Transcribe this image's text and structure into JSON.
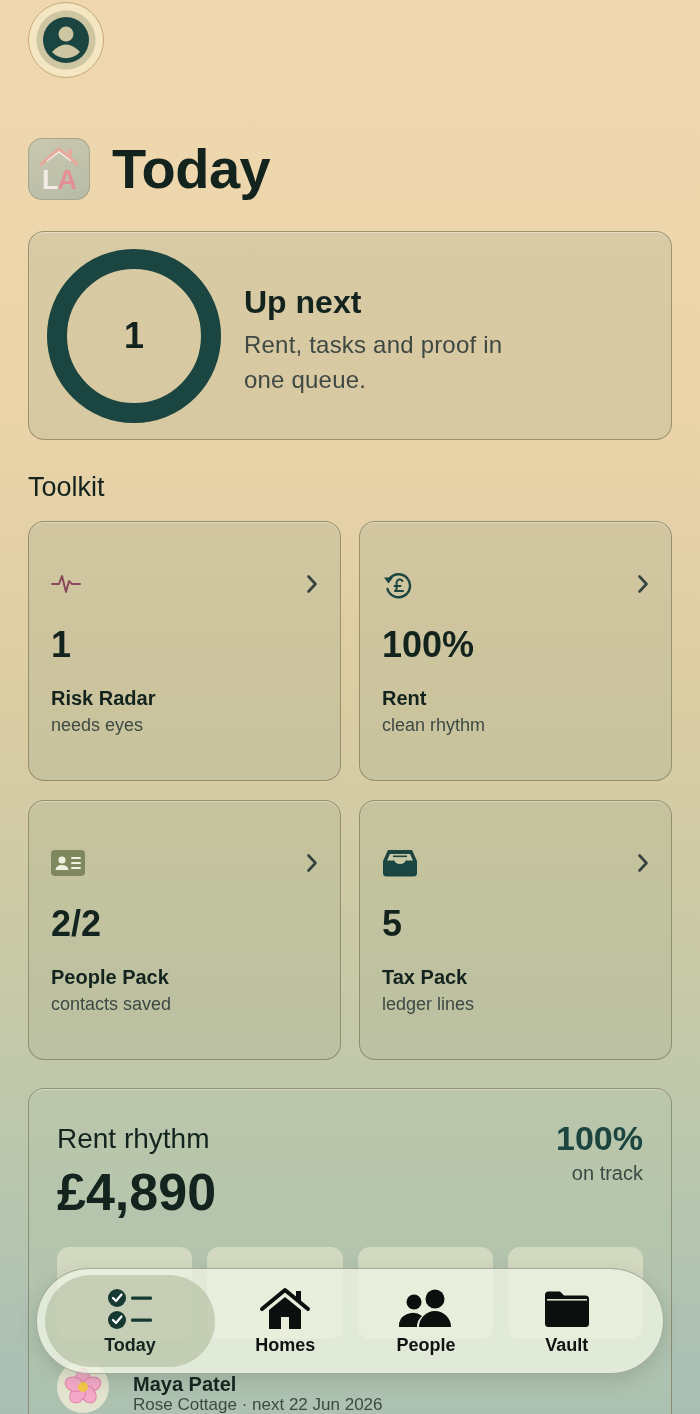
{
  "header": {
    "logo_text": "LA",
    "title": "Today"
  },
  "up_next": {
    "count": "1",
    "level": 1,
    "title": "Up next",
    "description": "Rent, tasks and proof in one queue."
  },
  "toolkit": {
    "title": "Toolkit",
    "tiles": [
      {
        "value": "1",
        "title": "Risk Radar",
        "subtitle": "needs eyes"
      },
      {
        "value": "100%",
        "title": "Rent",
        "subtitle": "clean rhythm"
      },
      {
        "value": "2/2",
        "title": "People Pack",
        "subtitle": "contacts saved"
      },
      {
        "value": "5",
        "title": "Tax Pack",
        "subtitle": "ledger lines"
      }
    ]
  },
  "rent_rhythm": {
    "title": "Rent rhythm",
    "amount": "£4,890",
    "percent": "100%",
    "status": "on track",
    "tenant": {
      "name": "Maya Patel",
      "detail": "Rose Cottage · next 22 Jun 2026"
    }
  },
  "tab_bar": {
    "tabs": [
      {
        "label": "Today",
        "selected": true
      },
      {
        "label": "Homes",
        "selected": false
      },
      {
        "label": "People",
        "selected": false
      },
      {
        "label": "Vault",
        "selected": false
      }
    ]
  }
}
